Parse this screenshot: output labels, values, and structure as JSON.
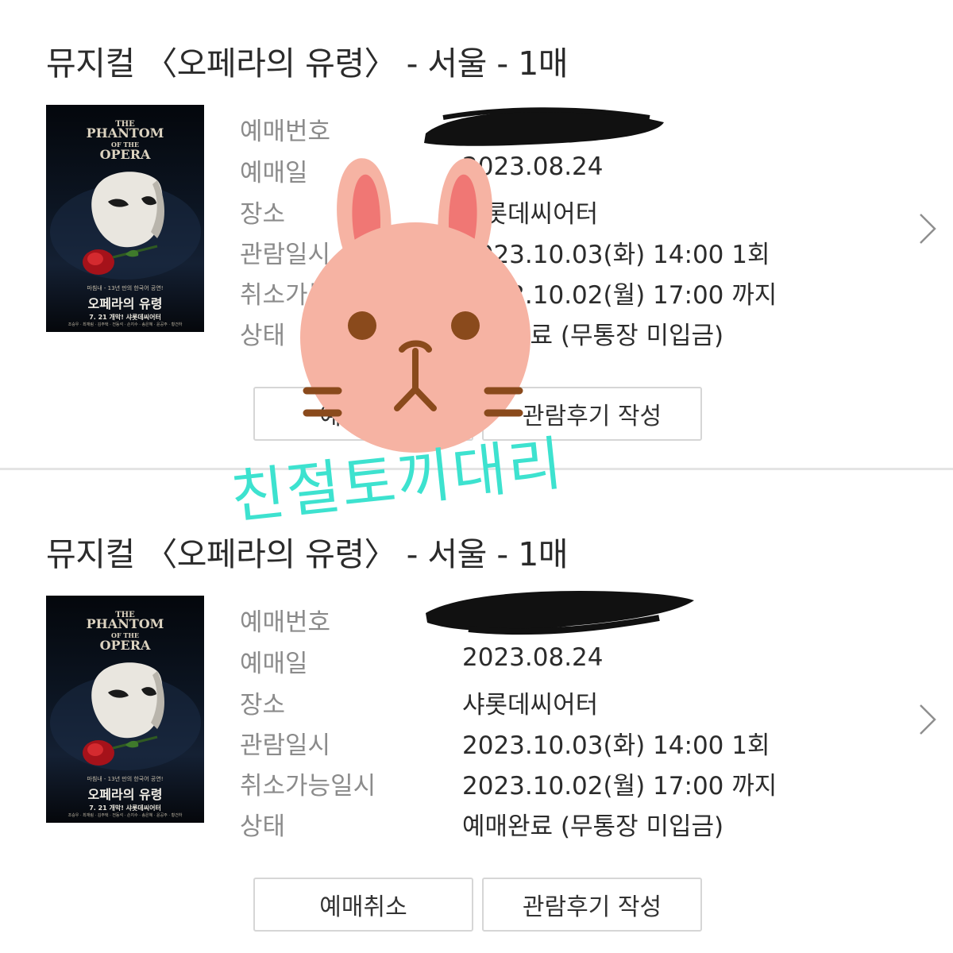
{
  "bookings": [
    {
      "title": "뮤지컬 〈오페라의 유령〉 - 서울 - 1매",
      "poster": {
        "the": "THE",
        "phantom": "PHANTOM",
        "of_the": "OF THE",
        "opera": "OPERA",
        "tagline": "마침내 - 13년 만의 한국어 공연!",
        "korean_title": "오페라의 유령",
        "date_venue": "7. 21 개막! 샤롯데씨어터",
        "cast": "조승우 · 최재림 · 김주택 · 전동석 · 손지수 · 송은혜 · 윤공주 · 황건하"
      },
      "fields": [
        {
          "label": "예매번호",
          "value": ""
        },
        {
          "label": "예매일",
          "value": "2023.08.24"
        },
        {
          "label": "장소",
          "value": "샤롯데씨어터"
        },
        {
          "label": "관람일시",
          "value": "2023.10.03(화) 14:00 1회"
        },
        {
          "label": "취소가능일시",
          "value": "2023.10.02(월) 17:00 까지"
        },
        {
          "label": "상태",
          "value": "예매완료 (무통장 미입금)"
        }
      ],
      "buttons": {
        "cancel": "예매취소",
        "review": "관람후기 작성"
      }
    },
    {
      "title": "뮤지컬 〈오페라의 유령〉 - 서울 - 1매",
      "poster": {
        "the": "THE",
        "phantom": "PHANTOM",
        "of_the": "OF THE",
        "opera": "OPERA",
        "tagline": "마침내 - 13년 만의 한국어 공연!",
        "korean_title": "오페라의 유령",
        "date_venue": "7. 21 개막! 샤롯데씨어터",
        "cast": "조승우 · 최재림 · 김주택 · 전동석 · 손지수 · 송은혜 · 윤공주 · 황건하"
      },
      "fields": [
        {
          "label": "예매번호",
          "value": ""
        },
        {
          "label": "예매일",
          "value": "2023.08.24"
        },
        {
          "label": "장소",
          "value": "샤롯데씨어터"
        },
        {
          "label": "관람일시",
          "value": "2023.10.03(화) 14:00 1회"
        },
        {
          "label": "취소가능일시",
          "value": "2023.10.02(월) 17:00 까지"
        },
        {
          "label": "상태",
          "value": "예매완료 (무통장 미입금)"
        }
      ],
      "buttons": {
        "cancel": "예매취소",
        "review": "관람후기 작성"
      }
    }
  ],
  "watermark": {
    "text": "친절토끼대리",
    "color": "#3de2cf"
  },
  "colors": {
    "rabbit_face": "#f6b3a3",
    "rabbit_ear_inner": "#f07774",
    "rabbit_features": "#8a4a1c",
    "redaction": "#111111"
  },
  "icons": {
    "chevron": "chevron-right-icon",
    "sticker": "rabbit-sticker"
  }
}
